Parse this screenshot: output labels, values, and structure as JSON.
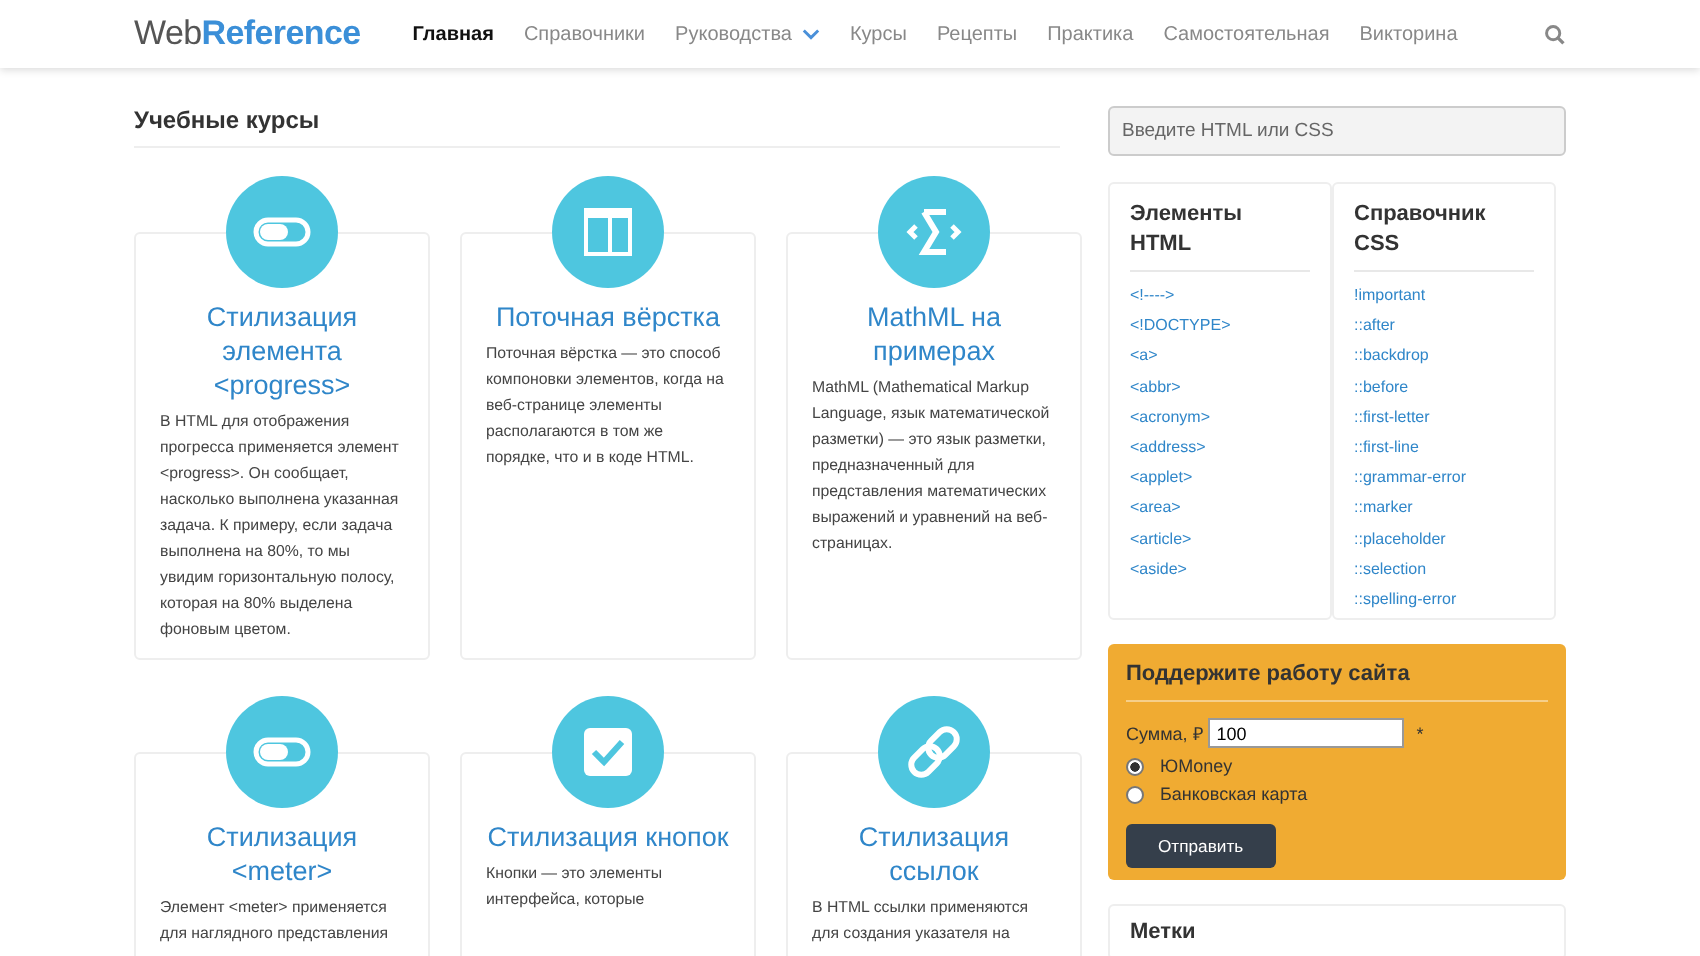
{
  "header": {
    "logo_first": "Web",
    "logo_second": "Reference",
    "nav": [
      {
        "label": "Главная",
        "selected": true,
        "has_menu": false
      },
      {
        "label": "Справочники",
        "selected": false,
        "has_menu": false
      },
      {
        "label": "Руководства",
        "selected": false,
        "has_menu": true
      },
      {
        "label": "Курсы",
        "selected": false,
        "has_menu": false
      },
      {
        "label": "Рецепты",
        "selected": false,
        "has_menu": false
      },
      {
        "label": "Практика",
        "selected": false,
        "has_menu": false
      },
      {
        "label": "Самостоятельная",
        "selected": false,
        "has_menu": false
      },
      {
        "label": "Викторина",
        "selected": false,
        "has_menu": false
      }
    ]
  },
  "section_title": "Учебные курсы",
  "courses": [
    {
      "kind": "pill",
      "title": "Стилизация элемента <progress>",
      "text": "В HTML для отображения прогресса применяется элемент <progress>. Он сообщает, насколько выполнена указанная задача. К примеру, если задача выполнена на 80%, то мы увидим горизонтальную полосу, которая на 80% выделена фоновым цветом."
    },
    {
      "kind": "layout",
      "title": "Поточная вёрстка",
      "text": "Поточная вёрстка — это способ компоновки элементов, когда на веб-странице элементы располагаются в том же порядке, что и в коде HTML."
    },
    {
      "kind": "sigma",
      "title": "MathML на примерах",
      "text": "MathML (Mathematical Markup Language, язык математической разметки) — это язык разметки, предназначенный для представления математических выражений и уравнений на веб-страницах."
    },
    {
      "kind": "pill",
      "title": "Стилизация <meter>",
      "text": "Элемент <meter> применяется для наглядного представления"
    },
    {
      "kind": "check",
      "title": "Стилизация кнопок",
      "text": "Кнопки — это элементы интерфейса, которые"
    },
    {
      "kind": "link",
      "title": "Стилизация ссылок",
      "text": "В HTML ссылки применяются для создания указателя на"
    }
  ],
  "search": {
    "placeholder": "Введите HTML или CSS"
  },
  "html_panel": {
    "title": "Элементы HTML",
    "links": [
      "<!---->",
      "<!DOCTYPE>",
      "<a>",
      "<abbr>",
      "<acronym>",
      "<address>",
      "<applet>",
      "<area>",
      "<article>",
      "<aside>"
    ]
  },
  "css_panel": {
    "title": "Справочник CSS",
    "links": [
      "!important",
      "::after",
      "::backdrop",
      "::before",
      "::first-letter",
      "::first-line",
      "::grammar-error",
      "::marker",
      "::placeholder",
      "::selection",
      "::spelling-error"
    ]
  },
  "donate": {
    "title": "Поддержите работу сайта",
    "amount_label": "Сумма, ₽",
    "amount": "100",
    "required_mark": "*",
    "options": [
      {
        "label": "ЮMoney",
        "selected": true
      },
      {
        "label": "Банковская карта",
        "selected": false
      }
    ],
    "submit": "Отправить"
  },
  "tags_panel": {
    "title": "Метки"
  }
}
